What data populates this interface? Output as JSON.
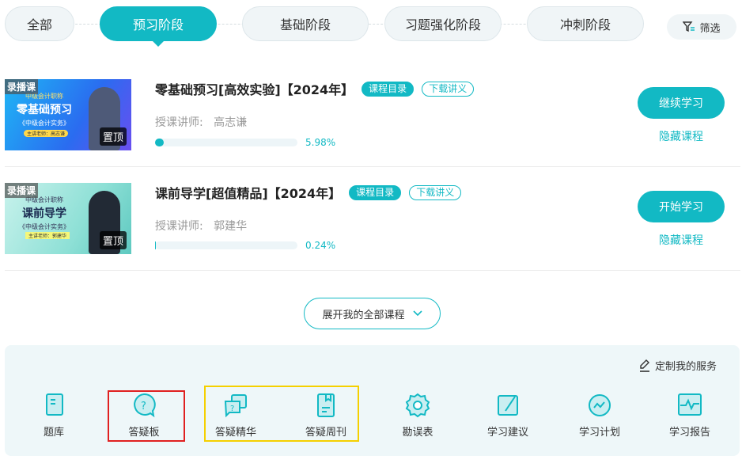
{
  "stages": {
    "tabs": [
      {
        "label": "全部"
      },
      {
        "label": "预习阶段",
        "active": true
      },
      {
        "label": "基础阶段"
      },
      {
        "label": "习题强化阶段"
      },
      {
        "label": "冲刺阶段"
      }
    ],
    "filter_label": "筛选"
  },
  "courses": [
    {
      "badge": "录播课",
      "thumb_sub": "中级会计职称",
      "thumb_title": "零基础预习",
      "thumb_book": "《中级会计实务》",
      "thumb_teacher": "主讲老师：高志谦",
      "pin": "置顶",
      "title": "零基础预习[高效实验]【2024年】",
      "catalog": "课程目录",
      "download": "下载讲义",
      "teacher_label": "授课讲师:",
      "teacher": "高志谦",
      "progress": 5.98,
      "progress_text": "5.98%",
      "action": "继续学习",
      "hide": "隐藏课程"
    },
    {
      "badge": "录播课",
      "thumb_sub": "中级会计职称",
      "thumb_title": "课前导学",
      "thumb_book": "《中级会计实务》",
      "thumb_teacher": "主讲老师：郭建华",
      "pin": "置顶",
      "title": "课前导学[超值精品]【2024年】",
      "catalog": "课程目录",
      "download": "下载讲义",
      "teacher_label": "授课讲师:",
      "teacher": "郭建华",
      "progress": 0.24,
      "progress_text": "0.24%",
      "action": "开始学习",
      "hide": "隐藏课程"
    }
  ],
  "expand_label": "展开我的全部课程",
  "services": {
    "customize": "定制我的服务",
    "items": [
      {
        "label": "题库"
      },
      {
        "label": "答疑板"
      },
      {
        "label": "答疑精华"
      },
      {
        "label": "答疑周刊"
      },
      {
        "label": "勘误表"
      },
      {
        "label": "学习建议"
      },
      {
        "label": "学习计划"
      },
      {
        "label": "学习报告"
      }
    ]
  },
  "colors": {
    "accent": "#12b9c4",
    "highlight_red": "#e02020",
    "highlight_yellow": "#f5d000"
  }
}
